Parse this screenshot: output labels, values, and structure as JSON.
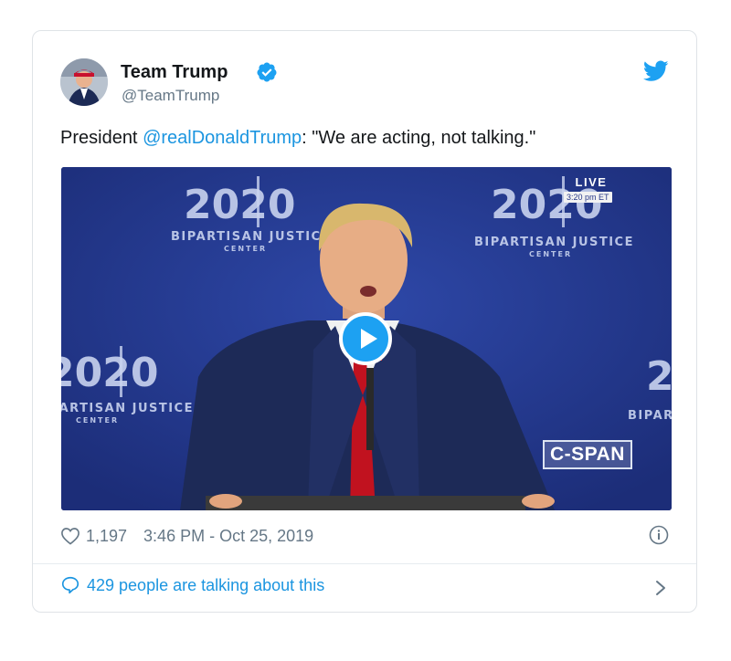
{
  "tweet": {
    "author_name": "Team Trump",
    "handle": "@TeamTrump",
    "text_prefix": "President ",
    "mention": "@realDonaldTrump",
    "text_suffix": ": \"We are acting, not talking.\"",
    "likes": "1,197",
    "timestamp": "3:46 PM - Oct 25, 2019",
    "talking_about": "429 people are talking about this"
  },
  "media": {
    "live_label": "LIVE",
    "live_time": "3:20 pm ET",
    "network_logo": "C-SPAN",
    "backdrop_logo_number": "2020",
    "backdrop_line1": "BIPARTISAN JUSTICE",
    "backdrop_line2": "CENTER"
  },
  "icons": {
    "verified": "verified-badge-icon",
    "bird": "twitter-bird-icon",
    "heart": "heart-icon",
    "info": "info-icon",
    "bubble": "speech-bubble-icon",
    "chevron": "chevron-right-icon",
    "play": "play-icon"
  },
  "colors": {
    "accent": "#1da1f2",
    "link": "#1b95e0",
    "muted": "#657786",
    "media_background": "#24398a"
  }
}
